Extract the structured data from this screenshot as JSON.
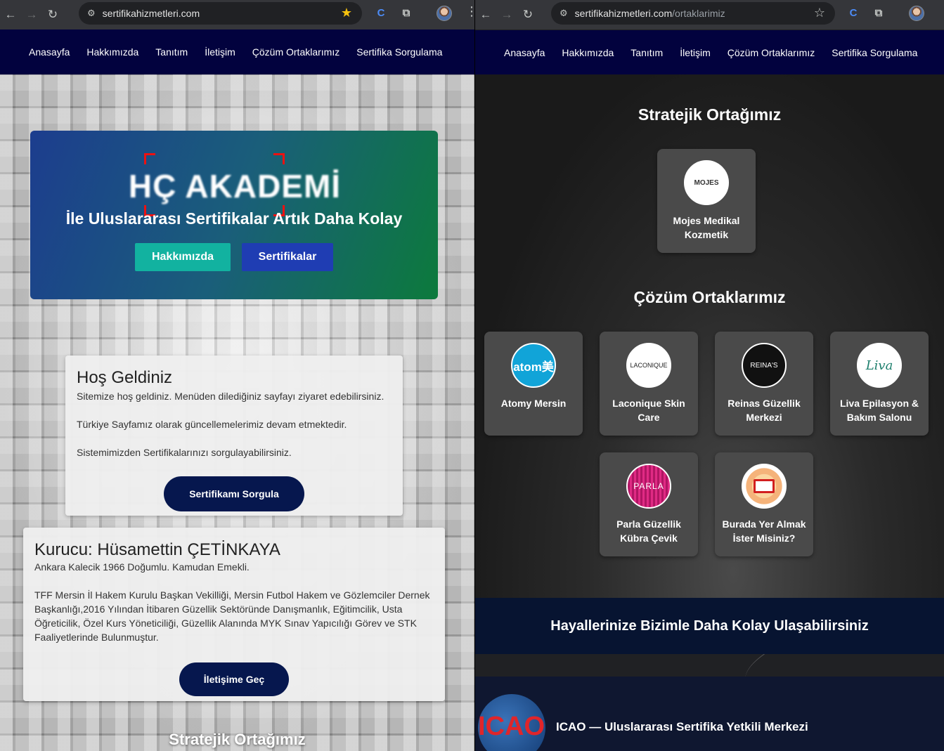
{
  "left": {
    "url": "sertifikahizmetleri.com",
    "nav": [
      "Anasayfa",
      "Hakkımızda",
      "Tanıtım",
      "İletişim",
      "Çözüm Ortaklarımız",
      "Sertifika Sorgulama"
    ],
    "hero": {
      "logo_text": "HÇ AKADEMİ",
      "subtitle": "İle Uluslararası Sertifikalar Artık Daha Kolay",
      "btn_about": "Hakkımızda",
      "btn_certs": "Sertifikalar"
    },
    "welcome": {
      "title": "Hoş Geldiniz",
      "p1": "Sitemize hoş geldiniz. Menüden dilediğiniz sayfayı ziyaret edebilirsiniz.",
      "p2": "Türkiye Sayfamız olarak güncellemelerimiz devam etmektedir.",
      "p3": "Sistemimizden Sertifikalarınızı sorgulayabilirsiniz.",
      "button": "Sertifikamı Sorgula"
    },
    "founder": {
      "title": "Kurucu: Hüsamettin ÇETİNKAYA",
      "p1": "Ankara Kalecik 1966 Doğumlu. Kamudan Emekli.",
      "p2": "TFF Mersin İl Hakem Kurulu Başkan Vekilliği, Mersin Futbol Hakem ve Gözlemciler Dernek Başkanlığı,2016 Yılından İtibaren Güzellik Sektöründe Danışmanlık, Eğitimcilik, Usta Öğreticilik, Özel Kurs Yöneticiliği, Güzellik Alanında MYK Sınav Yapıcılığı Görev ve STK Faaliyetlerinde Bulunmuştur.",
      "button": "İletişime Geç"
    },
    "bottom_title": "Stratejik Ortağımız"
  },
  "right": {
    "url_host": "sertifikahizmetleri.com",
    "url_path": "/ortaklarimiz",
    "nav": [
      "Anasayfa",
      "Hakkımızda",
      "Tanıtım",
      "İletişim",
      "Çözüm Ortaklarımız",
      "Sertifika Sorgulama"
    ],
    "strategic_title": "Stratejik Ortağımız",
    "strategic_partner": {
      "name": "Mojes Medikal Kozmetik",
      "logo_text": "MOJES"
    },
    "solutions_title": "Çözüm Ortaklarımız",
    "partners": [
      {
        "name": "Atomy Mersin",
        "logo_text": "atom美"
      },
      {
        "name": "Laconique Skin Care",
        "logo_text": "LACONIQUE"
      },
      {
        "name": "Reinas Güzellik Merkezi",
        "logo_text": "REINA'S"
      },
      {
        "name": "Liva Epilasyon & Bakım Salonu",
        "logo_text": "Liva"
      },
      {
        "name": "Parla Güzellik Kübra Çevik",
        "logo_text": "PARLA"
      },
      {
        "name": "Burada Yer Almak İster Misiniz?",
        "logo_text": ""
      }
    ],
    "band_text": "Hayallerinize Bizimle Daha Kolay Ulaşabilirsiniz",
    "footer_logo": "ICAO",
    "footer_text": "ICAO — Uluslararası Sertifika Yetkili Merkezi"
  },
  "colors": {
    "nav_bg": "#02023e",
    "hero_btn_teal": "#12b2a0",
    "hero_btn_blue": "#1f3db3",
    "pill_btn": "#06174e",
    "card_dark": "#4a4a4a"
  }
}
